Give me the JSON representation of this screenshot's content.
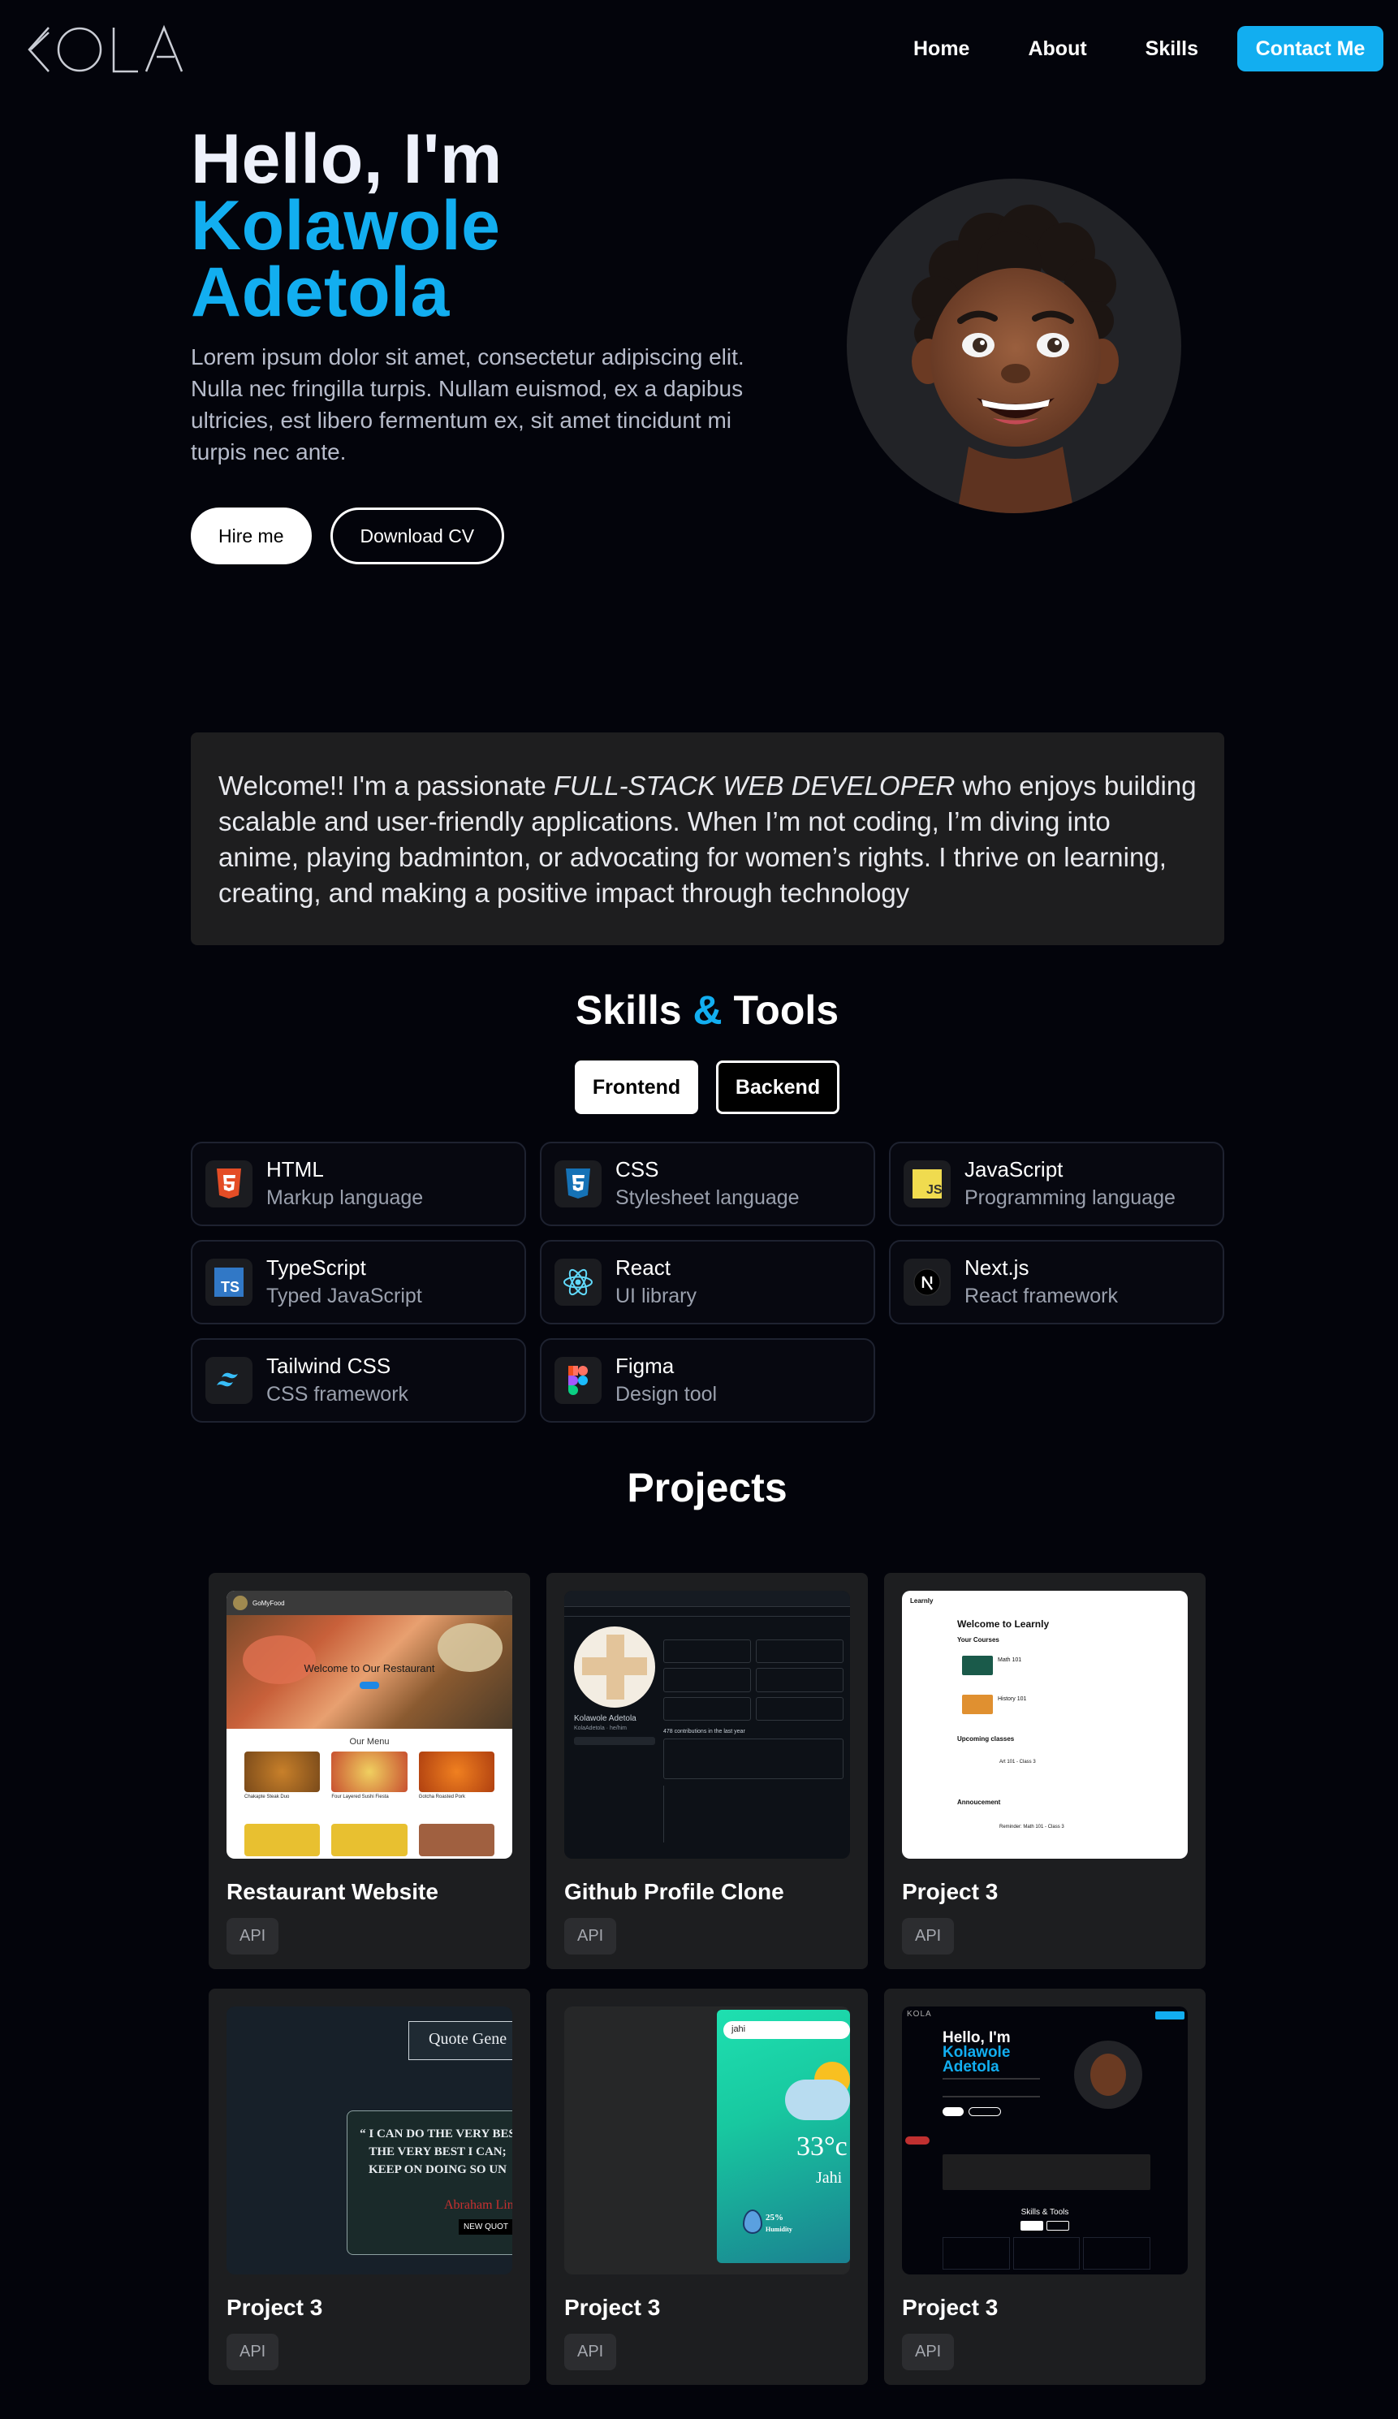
{
  "nav": {
    "logo_text": "KOLA",
    "links": [
      "Home",
      "About",
      "Skills"
    ],
    "contact_label": "Contact Me"
  },
  "hero": {
    "greeting": "Hello, I'm",
    "first_name": "Kolawole",
    "last_name": "Adetola",
    "description": "Lorem ipsum dolor sit amet, consectetur adipiscing elit. Nulla nec fringilla turpis. Nullam euismod, ex a dapibus ultricies, est libero fermentum ex, sit amet tincidunt mi turpis nec ante.",
    "hire_label": "Hire me",
    "cv_label": "Download CV"
  },
  "welcome": {
    "before": "Welcome!! I'm a passionate ",
    "emphasis": "FULL-STACK WEB DEVELOPER",
    "after": " who enjoys building scalable and user-friendly applications. When I’m not coding, I’m diving into anime, playing badminton, or advocating for women’s rights. I thrive on learning, creating, and making a positive impact through technology"
  },
  "skills": {
    "heading_a": "Skills",
    "heading_amp": "&",
    "heading_b": "Tools",
    "tabs": [
      "Frontend",
      "Backend"
    ],
    "items": [
      {
        "name": "HTML",
        "sub": "Markup language",
        "icon": "html5-icon",
        "color": "#e44d26"
      },
      {
        "name": "CSS",
        "sub": "Stylesheet language",
        "icon": "css3-icon",
        "color": "#1572b6"
      },
      {
        "name": "JavaScript",
        "sub": "Programming language",
        "icon": "javascript-icon",
        "color": "#f0db4f"
      },
      {
        "name": "TypeScript",
        "sub": "Typed JavaScript",
        "icon": "typescript-icon",
        "color": "#3178c6"
      },
      {
        "name": "React",
        "sub": "UI library",
        "icon": "react-icon",
        "color": "#61dafb"
      },
      {
        "name": "Next.js",
        "sub": "React framework",
        "icon": "nextjs-icon",
        "color": "#000000"
      },
      {
        "name": "Tailwind CSS",
        "sub": "CSS framework",
        "icon": "tailwind-icon",
        "color": "#38bdf8"
      },
      {
        "name": "Figma",
        "sub": "Design tool",
        "icon": "figma-icon",
        "color": "#f24e1e"
      }
    ]
  },
  "projects": {
    "heading": "Projects",
    "items": [
      {
        "title": "Restaurant Website",
        "tag": "API"
      },
      {
        "title": "Github Profile Clone",
        "tag": "API"
      },
      {
        "title": "Project 3",
        "tag": "API"
      },
      {
        "title": "Project 3",
        "tag": "API"
      },
      {
        "title": "Project 3",
        "tag": "API"
      },
      {
        "title": "Project 3",
        "tag": "API"
      }
    ],
    "thumbs": {
      "restaurant": {
        "brand": "GoMyFood",
        "hero": "Welcome to Our Restaurant",
        "menu": "Our Menu",
        "dishes": [
          "Chakapte Steak Duo",
          "Four Layered Sushi Fiesta",
          "Gotcha Roasted Pork"
        ]
      },
      "github": {
        "user": "Kolawole Adetola",
        "handle": "KolaAdetola · he/him",
        "contrib": "478 contributions in the last year"
      },
      "learnly": {
        "brand": "Learnly",
        "welcome": "Welcome to Learnly",
        "courses_title": "Your Courses",
        "courses": [
          "Math 101",
          "History 101"
        ],
        "upcoming_title": "Upcoming classes",
        "upcoming": "Art 101 - Class 3",
        "announce_title": "Annoucement",
        "announce": "Reminder: Math 101 - Class 3"
      },
      "quote": {
        "button": "Quote Gene",
        "text": "“ I CAN DO THE VERY BES THE VERY BEST I CAN; KEEP ON DOING SO UN",
        "author": "Abraham Lin",
        "new_quote": "NEW QUOT"
      },
      "weather": {
        "search": "jahi",
        "temp": "33°c",
        "city": "Jahi",
        "humidity": "25%",
        "humidity_label": "Humidity"
      },
      "portfolio": {
        "greeting": "Hello, I'm",
        "first": "Kolawole",
        "last": "Adetola",
        "skills": "Skills & Tools"
      }
    }
  }
}
